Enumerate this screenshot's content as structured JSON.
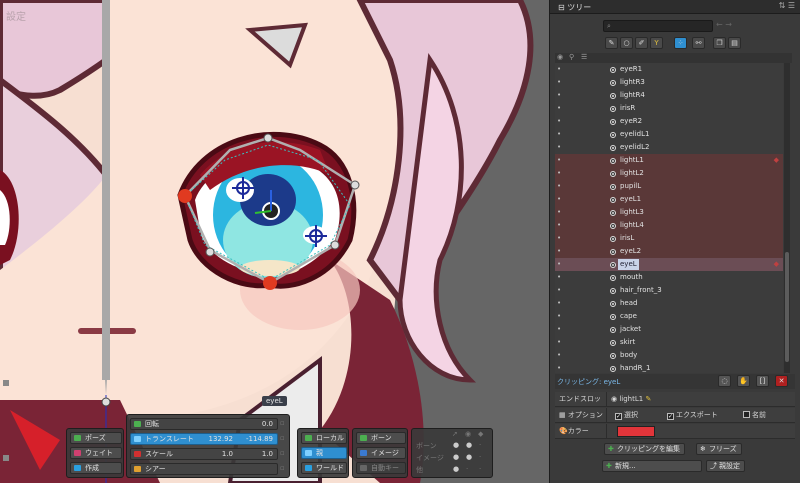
{
  "viewport": {
    "title": "設定",
    "bone_label": "eyeL",
    "toolbars": {
      "mode": {
        "pose": "ポーズ",
        "weight": "ウェイト",
        "create": "作成"
      },
      "transform": {
        "rotate": {
          "label": "回転",
          "value": "0.0"
        },
        "translate": {
          "label": "トランスレート",
          "x": "132.92",
          "y": "-114.89"
        },
        "scale": {
          "label": "スケール",
          "x": "1.0",
          "y": "1.0"
        },
        "shear": {
          "label": "シアー"
        }
      },
      "axes": {
        "local": "ローカル",
        "parent": "親",
        "world": "ワールド"
      },
      "targets": {
        "bone": "ボーン",
        "image": "イメージ",
        "auto_key": "自動キー"
      },
      "visibility": {
        "bone": "ボーン",
        "image": "イメージ",
        "other": "他"
      }
    }
  },
  "panel": {
    "tab": "ツリー",
    "search_placeholder": "",
    "filter_icons": [
      "brush-icon",
      "circle-icon",
      "pencil-icon",
      "bone-icon",
      "dots-icon",
      "link-icon",
      "copy-icon",
      "paste-icon"
    ],
    "tree_rows": [
      {
        "name": "eyeR1",
        "state": "normal"
      },
      {
        "name": "lightR3",
        "state": "normal"
      },
      {
        "name": "lightR4",
        "state": "normal"
      },
      {
        "name": "irisR",
        "state": "normal"
      },
      {
        "name": "eyeR2",
        "state": "normal"
      },
      {
        "name": "eyelidL1",
        "state": "normal"
      },
      {
        "name": "eyelidL2",
        "state": "normal"
      },
      {
        "name": "lightL1",
        "state": "clip"
      },
      {
        "name": "lightL2",
        "state": "clip"
      },
      {
        "name": "pupilL",
        "state": "clip"
      },
      {
        "name": "eyeL1",
        "state": "clip"
      },
      {
        "name": "lightL3",
        "state": "clip"
      },
      {
        "name": "lightL4",
        "state": "clip"
      },
      {
        "name": "irisL",
        "state": "clip"
      },
      {
        "name": "eyeL2",
        "state": "clip"
      },
      {
        "name": "eyeL",
        "state": "selected"
      },
      {
        "name": "mouth",
        "state": "normal"
      },
      {
        "name": "hair_front_3",
        "state": "normal"
      },
      {
        "name": "head",
        "state": "normal"
      },
      {
        "name": "cape",
        "state": "normal"
      },
      {
        "name": "jacket",
        "state": "normal"
      },
      {
        "name": "skirt",
        "state": "normal"
      },
      {
        "name": "body",
        "state": "normal"
      },
      {
        "name": "handR_1",
        "state": "normal"
      }
    ],
    "clipping_label": "クリッピング: eyeL",
    "end_slot": {
      "key": "エンドスロット",
      "value": "lightL1"
    },
    "options": {
      "key": "オプション",
      "select": "選択",
      "export": "エクスポート",
      "name": "名前"
    },
    "color": {
      "key": "カラー",
      "value": "#e2353a"
    },
    "buttons": {
      "edit_clipping": "クリッピングを編集",
      "freeze": "フリーズ",
      "new": "新規...",
      "parent_set": "親設定"
    }
  }
}
